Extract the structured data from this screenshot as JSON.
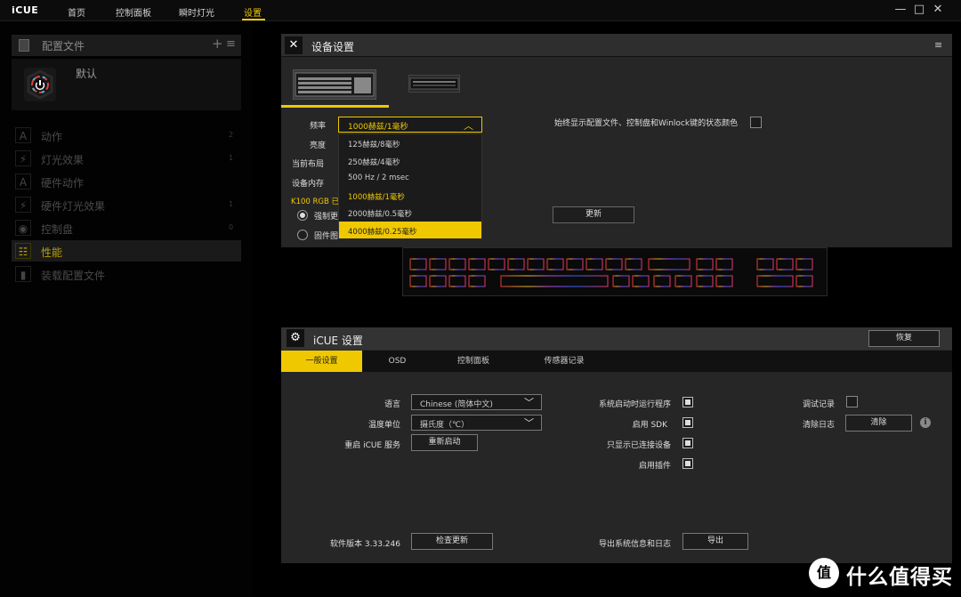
{
  "app": {
    "title": "iCUE"
  },
  "nav": {
    "tabs": [
      "首页",
      "控制面板",
      "瞬时灯光",
      "设置"
    ],
    "active": "设置"
  },
  "window_controls": {
    "minimize": "—",
    "maximize": "□",
    "close": "✕"
  },
  "sidebar": {
    "header": "配置文件",
    "add": "+",
    "menu": "≡",
    "profile_name": "默认",
    "items": [
      {
        "label": "动作",
        "icon": "A",
        "count": "2"
      },
      {
        "label": "灯光效果",
        "icon": "⚡",
        "count": "1"
      },
      {
        "label": "硬件动作",
        "icon": "A",
        "count": ""
      },
      {
        "label": "硬件灯光效果",
        "icon": "⚡",
        "count": "1"
      },
      {
        "label": "控制盘",
        "icon": "◉",
        "count": "0"
      },
      {
        "label": "性能",
        "icon": "☷",
        "count": ""
      },
      {
        "label": "装载配置文件",
        "icon": "▮",
        "count": ""
      }
    ],
    "active_item": "性能"
  },
  "device_settings": {
    "title": "设备设置",
    "labels": {
      "frequency": "频率",
      "brightness": "亮度",
      "layout": "当前布局",
      "memory": "设备内存"
    },
    "frequency": {
      "selected": "1000赫兹/1毫秒",
      "options": [
        "125赫兹/8毫秒",
        "250赫兹/4毫秒",
        "500 Hz / 2 msec",
        "1000赫兹/1毫秒",
        "2000赫兹/0.5毫秒",
        "4000赫兹/0.25毫秒"
      ],
      "highlighted": "4000赫兹/0.25毫秒"
    },
    "always_show": "始终显示配置文件、控制盘和Winlock键的状态颜色",
    "k100_note": "K100 RGB 已",
    "radio_force": "强制更",
    "radio_firmware": "固件图",
    "update_button": "更新"
  },
  "icue_settings": {
    "title": "iCUE 设置",
    "restore": "恢复",
    "tabs": [
      "一般设置",
      "OSD",
      "控制面板",
      "传感器记录"
    ],
    "general": {
      "language_label": "语言",
      "language_value": "Chinese (简体中文)",
      "temp_label": "温度单位",
      "temp_value": "摄氏度（℃）",
      "restart_label": "重启 iCUE 服务",
      "restart_button": "重新启动",
      "startup_label": "系统启动时运行程序",
      "sdk_label": "启用 SDK",
      "connected_only_label": "只显示已连接设备",
      "plugins_label": "启用插件",
      "debug_label": "调试记录",
      "clear_log_label": "清除日志",
      "clear_button": "清除",
      "version_label": "软件版本 3.33.246",
      "check_update_button": "检查更新",
      "export_label": "导出系统信息和日志",
      "export_button": "导出"
    }
  },
  "watermark": {
    "circle": "值",
    "text": "什么值得买"
  },
  "colors": {
    "accent": "#f0c800",
    "panel": "#262626"
  }
}
